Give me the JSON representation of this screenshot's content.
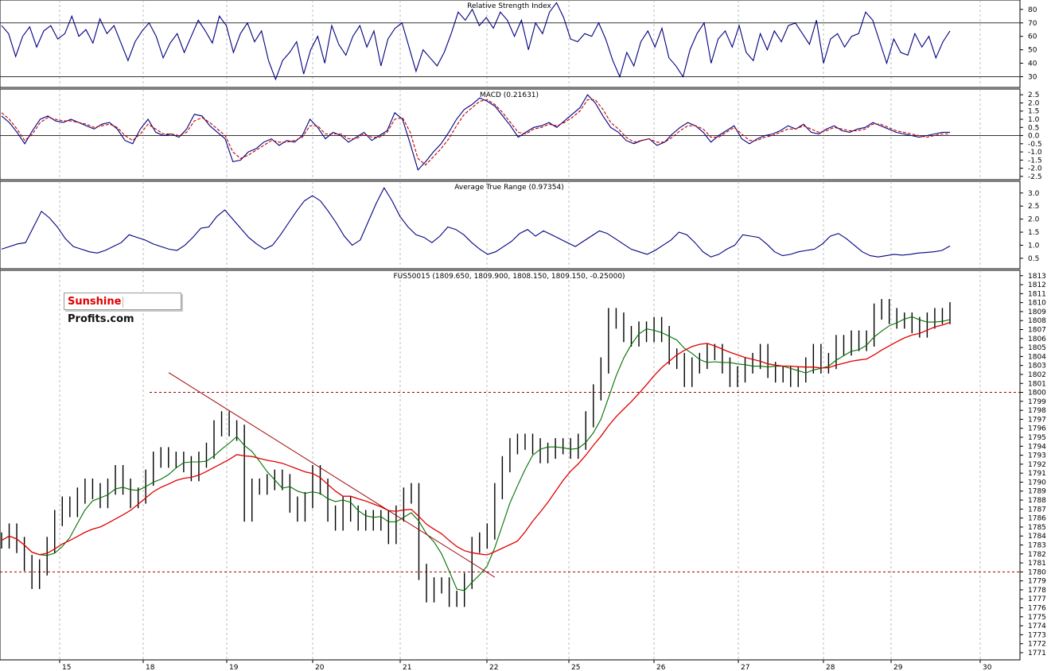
{
  "colors": {
    "background": "#ffffff",
    "line_primary": "#000080",
    "macd_signal": "#c00000",
    "ma_fast": "#007000",
    "ma_slow": "#e00000",
    "trendline": "#a00000",
    "support": "#a00000",
    "grid": "#a0a0a0",
    "logo_red": "#e00000"
  },
  "logo": {
    "part1": "Sunshine",
    "part2": "Profits.com"
  },
  "chart_data": [
    {
      "type": "line",
      "title": "Relative Strength Index",
      "ylim": [
        22,
        87
      ],
      "yticks": [
        "80",
        "70",
        "60",
        "50",
        "40",
        "30"
      ],
      "reference_lines": [
        70,
        30
      ],
      "grid": true,
      "series": [
        {
          "values": [
            68,
            62,
            45,
            60,
            67,
            52,
            64,
            68,
            58,
            62,
            75,
            60,
            65,
            55,
            73,
            62,
            68,
            55,
            42,
            56,
            64,
            70,
            60,
            44,
            55,
            62,
            48,
            60,
            72,
            64,
            55,
            75,
            68,
            48,
            62,
            70,
            56,
            64,
            42,
            28,
            42,
            48,
            56,
            32,
            50,
            60,
            40,
            68,
            54,
            46,
            60,
            68,
            52,
            64,
            38,
            58,
            66,
            70,
            52,
            34,
            50,
            44,
            38,
            48,
            62,
            78,
            72,
            80,
            68,
            74,
            66,
            78,
            72,
            60,
            72,
            50,
            70,
            62,
            78,
            85,
            74,
            58,
            56,
            62,
            60,
            70,
            58,
            42,
            30,
            48,
            38,
            56,
            64,
            52,
            66,
            44,
            38,
            30,
            50,
            62,
            70,
            40,
            58,
            64,
            52,
            68,
            48,
            42,
            62,
            50,
            64,
            56,
            68,
            70,
            62,
            54,
            72,
            40,
            58,
            62,
            52,
            60,
            62,
            78,
            72,
            56,
            40,
            58,
            48,
            46,
            62,
            52,
            60,
            44,
            56,
            64
          ]
        }
      ]
    },
    {
      "type": "line",
      "title": "MACD (0.21631)",
      "ylim": [
        -2.7,
        2.85
      ],
      "yticks": [
        "2.5",
        "2.0",
        "1.5",
        "1.0",
        "0.5",
        "0.0",
        "-0.5",
        "-1.0",
        "-1.5",
        "-2.0",
        "-2.5"
      ],
      "reference_lines": [
        0
      ],
      "grid": true,
      "series": [
        {
          "values": [
            1.2,
            0.8,
            0.2,
            -0.5,
            0.3,
            1.0,
            1.2,
            0.9,
            0.8,
            1.0,
            0.8,
            0.6,
            0.4,
            0.7,
            0.8,
            0.4,
            -0.3,
            -0.5,
            0.4,
            1.0,
            0.2,
            0.0,
            0.1,
            -0.1,
            0.4,
            1.3,
            1.2,
            0.6,
            0.2,
            -0.2,
            -1.6,
            -1.5,
            -1.0,
            -0.8,
            -0.4,
            -0.2,
            -0.6,
            -0.3,
            -0.4,
            0.0,
            1.0,
            0.5,
            -0.2,
            0.2,
            0.0,
            -0.4,
            -0.1,
            0.2,
            -0.3,
            0.0,
            0.3,
            1.4,
            1.0,
            -0.5,
            -2.1,
            -1.6,
            -1.0,
            -0.5,
            0.2,
            1.0,
            1.6,
            1.9,
            2.3,
            2.1,
            1.8,
            1.2,
            0.6,
            -0.1,
            0.2,
            0.5,
            0.6,
            0.8,
            0.5,
            0.9,
            1.3,
            1.7,
            2.5,
            2.0,
            1.2,
            0.5,
            0.2,
            -0.3,
            -0.5,
            -0.3,
            -0.2,
            -0.6,
            -0.4,
            0.1,
            0.5,
            0.8,
            0.6,
            0.2,
            -0.4,
            0.0,
            0.3,
            0.6,
            -0.2,
            -0.5,
            -0.2,
            0.0,
            0.1,
            0.3,
            0.6,
            0.4,
            0.7,
            0.2,
            0.1,
            0.4,
            0.6,
            0.3,
            0.2,
            0.4,
            0.5,
            0.8,
            0.6,
            0.4,
            0.2,
            0.1,
            0.0,
            -0.1,
            0.0,
            0.1,
            0.2,
            0.2
          ]
        },
        {
          "values": [
            1.4,
            1.0,
            0.4,
            -0.3,
            0.1,
            0.8,
            1.1,
            1.0,
            0.9,
            0.9,
            0.8,
            0.7,
            0.5,
            0.6,
            0.7,
            0.5,
            0.0,
            -0.3,
            0.1,
            0.7,
            0.4,
            0.1,
            0.1,
            0.0,
            0.2,
            0.9,
            1.1,
            0.8,
            0.4,
            0.0,
            -1.0,
            -1.4,
            -1.2,
            -0.9,
            -0.6,
            -0.3,
            -0.4,
            -0.4,
            -0.3,
            -0.1,
            0.6,
            0.6,
            0.1,
            0.1,
            0.1,
            -0.2,
            -0.2,
            0.1,
            -0.1,
            -0.1,
            0.2,
            1.0,
            1.1,
            0.2,
            -1.4,
            -1.8,
            -1.3,
            -0.8,
            -0.2,
            0.6,
            1.3,
            1.7,
            2.1,
            2.2,
            1.9,
            1.4,
            0.8,
            0.2,
            0.1,
            0.4,
            0.5,
            0.7,
            0.6,
            0.8,
            1.1,
            1.5,
            2.2,
            2.2,
            1.6,
            0.8,
            0.4,
            -0.1,
            -0.4,
            -0.3,
            -0.2,
            -0.4,
            -0.4,
            -0.1,
            0.3,
            0.6,
            0.6,
            0.4,
            -0.1,
            -0.1,
            0.2,
            0.5,
            0.1,
            -0.3,
            -0.3,
            -0.1,
            0.0,
            0.2,
            0.4,
            0.4,
            0.6,
            0.4,
            0.2,
            0.3,
            0.5,
            0.4,
            0.3,
            0.3,
            0.4,
            0.7,
            0.7,
            0.5,
            0.3,
            0.2,
            0.1,
            0.0,
            -0.1,
            0.0,
            0.1,
            0.1
          ]
        }
      ]
    },
    {
      "type": "line",
      "title": "Average True Range (0.97354)",
      "ylim": [
        0.1,
        3.45
      ],
      "yticks": [
        "3.0",
        "2.5",
        "2.0",
        "1.5",
        "1.0",
        "0.5"
      ],
      "grid": true,
      "series": [
        {
          "values": [
            0.85,
            0.95,
            1.05,
            1.1,
            1.7,
            2.3,
            2.05,
            1.7,
            1.25,
            0.95,
            0.85,
            0.75,
            0.7,
            0.8,
            0.95,
            1.1,
            1.4,
            1.3,
            1.2,
            1.05,
            0.95,
            0.85,
            0.8,
            1.0,
            1.3,
            1.65,
            1.7,
            2.1,
            2.35,
            2.0,
            1.65,
            1.3,
            1.05,
            0.85,
            1.0,
            1.4,
            1.85,
            2.3,
            2.7,
            2.9,
            2.7,
            2.3,
            1.85,
            1.35,
            1.0,
            1.2,
            1.9,
            2.6,
            3.2,
            2.7,
            2.1,
            1.7,
            1.4,
            1.3,
            1.1,
            1.35,
            1.7,
            1.6,
            1.4,
            1.1,
            0.85,
            0.65,
            0.75,
            0.95,
            1.15,
            1.45,
            1.6,
            1.35,
            1.55,
            1.4,
            1.25,
            1.1,
            0.95,
            1.15,
            1.35,
            1.55,
            1.45,
            1.25,
            1.05,
            0.85,
            0.75,
            0.65,
            0.8,
            1.0,
            1.2,
            1.5,
            1.4,
            1.1,
            0.75,
            0.55,
            0.65,
            0.85,
            1.0,
            1.4,
            1.35,
            1.3,
            1.05,
            0.75,
            0.6,
            0.65,
            0.75,
            0.8,
            0.85,
            1.05,
            1.35,
            1.45,
            1.25,
            1.0,
            0.75,
            0.6,
            0.55,
            0.6,
            0.65,
            0.62,
            0.65,
            0.7,
            0.72,
            0.75,
            0.8,
            0.97
          ]
        }
      ]
    },
    {
      "type": "bar",
      "title": "FUS50015 (1809.650, 1809.900, 1808.150, 1809.150, -0.25000)",
      "ylim": [
        1770.2,
        1813.6
      ],
      "yticks": [
        "1813",
        "1812",
        "1811",
        "1810",
        "1809",
        "1808",
        "1807",
        "1806",
        "1805",
        "1804",
        "1803",
        "1802",
        "1801",
        "1800",
        "1799",
        "1798",
        "1797",
        "1796",
        "1795",
        "1794",
        "1793",
        "1792",
        "1791",
        "1790",
        "1789",
        "1788",
        "1787",
        "1786",
        "1785",
        "1784",
        "1783",
        "1782",
        "1781",
        "1780",
        "1779",
        "1778",
        "1777",
        "1776",
        "1775",
        "1774",
        "1773",
        "1772",
        "1771"
      ],
      "x_labels": [
        "15",
        "18",
        "19",
        "20",
        "21",
        "22",
        "25",
        "26",
        "27",
        "28",
        "29",
        "30"
      ],
      "reference_lines": [
        1800,
        1780
      ],
      "grid": true,
      "series": [
        {
          "values": [
            1783.5,
            1784.5,
            1783.0,
            1781.0,
            1779.0,
            1780.5,
            1783.0,
            1786.0,
            1787.5,
            1787.0,
            1788.5,
            1789.5,
            1789.0,
            1788.0,
            1789.5,
            1791.0,
            1789.5,
            1788.0,
            1788.5,
            1790.5,
            1792.5,
            1793.0,
            1792.5,
            1792.5,
            1792.0,
            1791.0,
            1792.5,
            1793.5,
            1796.0,
            1797.0,
            1796.0,
            1795.5,
            1786.5,
            1789.5,
            1789.5,
            1790.0,
            1790.5,
            1790.0,
            1787.5,
            1786.5,
            1788.0,
            1791.0,
            1789.5,
            1786.5,
            1785.5,
            1787.5,
            1786.5,
            1785.5,
            1786.0,
            1785.5,
            1786.0,
            1784.0,
            1786.5,
            1788.5,
            1789.0,
            1780.0,
            1777.5,
            1778.5,
            1778.5,
            1777.0,
            1777.0,
            1779.0,
            1783.0,
            1783.5,
            1784.5,
            1789.0,
            1792.0,
            1794.0,
            1794.5,
            1794.5,
            1794.0,
            1793.0,
            1793.5,
            1794.0,
            1794.0,
            1793.5,
            1794.5,
            1797.0,
            1800.0,
            1803.0,
            1808.5,
            1808.0,
            1806.5,
            1806.0,
            1807.0,
            1806.5,
            1807.5,
            1806.5,
            1804.0,
            1803.5,
            1801.5,
            1803.0,
            1803.5,
            1804.5,
            1804.5,
            1803.0,
            1801.5,
            1802.0,
            1803.0,
            1803.5,
            1804.5,
            1802.5,
            1802.0,
            1802.0,
            1801.5,
            1802.0,
            1803.0,
            1804.5,
            1803.0,
            1803.5,
            1805.5,
            1805.0,
            1806.0,
            1805.5,
            1806.0,
            1809.0,
            1809.5,
            1808.5,
            1808.0,
            1808.0,
            1807.5,
            1807.0,
            1808.0,
            1808.5,
            1808.5,
            1809.15
          ]
        }
      ]
    }
  ]
}
